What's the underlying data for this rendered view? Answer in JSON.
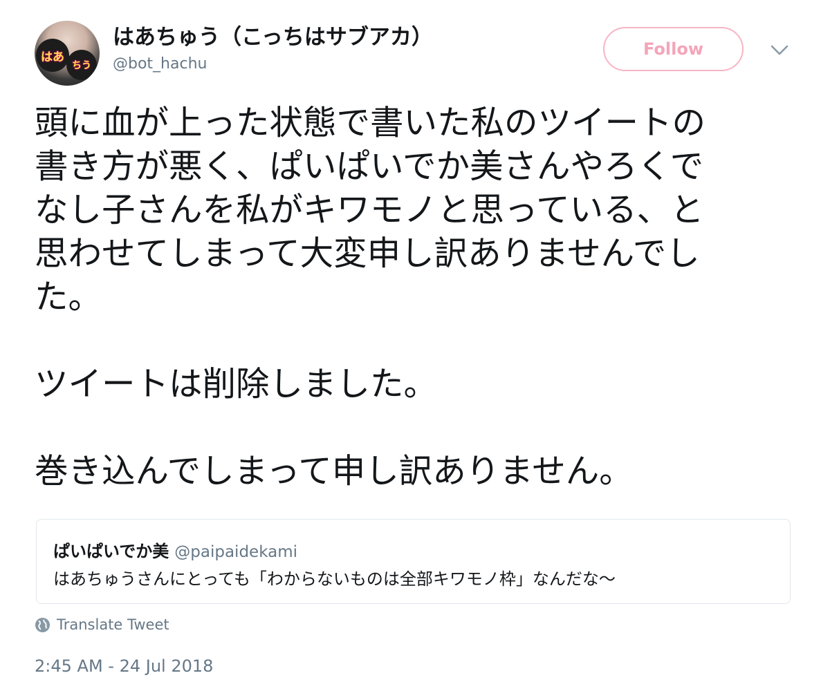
{
  "author": {
    "display_name": "はあちゅう（こっちはサブアカ）",
    "handle": "@bot_hachu",
    "avatar_icon": "profile-photo",
    "avatar_sign_a": "はあ",
    "avatar_sign_b": "ちう"
  },
  "follow_button": {
    "label": "Follow",
    "color": "#f3a5b9"
  },
  "menu_icon": "chevron-down-icon",
  "tweet": {
    "lines": [
      "頭に血が上った状態で書いた私のツイートの",
      "書き方が悪く、ぱいぱいでか美さんやろくで",
      "なし子さんを私がキワモノと思っている、と",
      "思わせてしまって大変申し訳ありませんでし",
      "た。",
      "ツイートは削除しました。",
      "巻き込んでしまって申し訳ありません。"
    ]
  },
  "quoted_tweet": {
    "name": "ぱいぱいでか美",
    "handle": "@paipaidekami",
    "text": "はあちゅうさんにとっても「わからないものは全部キワモノ枠」なんだな〜"
  },
  "translate": {
    "icon": "globe-icon",
    "label": "Translate Tweet"
  },
  "timestamp": "2:45 AM - 24 Jul 2018",
  "colors": {
    "text": "#14171a",
    "muted": "#657786",
    "border": "#e1e8ed",
    "follow_border": "#f7b4c4"
  }
}
